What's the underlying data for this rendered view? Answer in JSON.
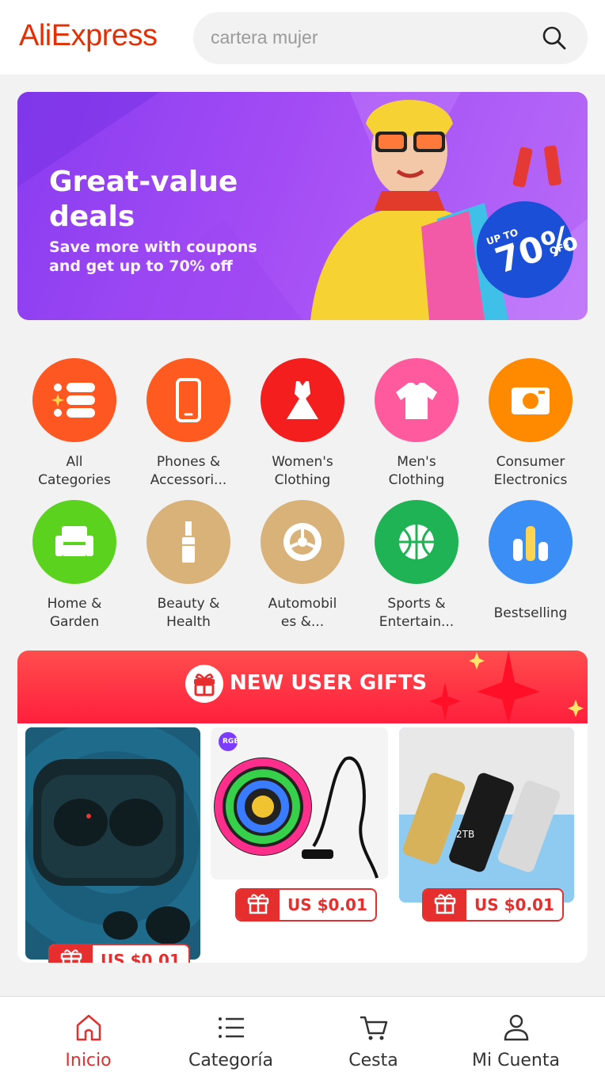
{
  "header": {
    "logo": "AliExpress",
    "search_placeholder": "cartera mujer"
  },
  "banner": {
    "title_line1": "Great-value",
    "title_line2": "deals",
    "subtitle_line1": "Save more with coupons",
    "subtitle_line2": "and get up to 70% off",
    "badge_top": "UP TO",
    "badge_value": "70%",
    "badge_bottom": "OFF"
  },
  "categories": [
    {
      "line1": "All",
      "line2": "Categories",
      "icon": "all-categories-icon",
      "color": "#ff5722"
    },
    {
      "line1": "Phones &",
      "line2": "Accessori...",
      "icon": "phone-icon",
      "color": "#ff5a1f"
    },
    {
      "line1": "Women's",
      "line2": "Clothing",
      "icon": "dress-icon",
      "color": "#f51e1e"
    },
    {
      "line1": "Men's",
      "line2": "Clothing",
      "icon": "tshirt-icon",
      "color": "#ff5a9e"
    },
    {
      "line1": "Consumer",
      "line2": "Electronics",
      "icon": "camera-icon",
      "color": "#ff8a00"
    },
    {
      "line1": "Home &",
      "line2": "Garden",
      "icon": "armchair-icon",
      "color": "#5ad21e"
    },
    {
      "line1": "Beauty &",
      "line2": "Health",
      "icon": "lipstick-icon",
      "color": "#d9b27a"
    },
    {
      "line1": "Automobil",
      "line2": "es &...",
      "icon": "wheel-icon",
      "color": "#d9b27a"
    },
    {
      "line1": "Sports &",
      "line2": "Entertain...",
      "icon": "basketball-icon",
      "color": "#1fb356"
    },
    {
      "line1": "Bestselling",
      "line2": "",
      "icon": "bar-chart-icon",
      "color": "#3a8ef5"
    }
  ],
  "gifts": {
    "title": "NEW USER GIFTS",
    "products": [
      {
        "name": "wireless-earbuds",
        "price": "US $0.01"
      },
      {
        "name": "rgb-led-strip",
        "price": "US $0.01",
        "badge": "RGB"
      },
      {
        "name": "usb-flash-drive",
        "price": "US $0.01",
        "drive_label": "2TB"
      }
    ]
  },
  "nav": {
    "items": [
      {
        "label": "Inicio",
        "active": true
      },
      {
        "label": "Categoría",
        "active": false
      },
      {
        "label": "Cesta",
        "active": false
      },
      {
        "label": "Mi Cuenta",
        "active": false
      }
    ]
  },
  "colors": {
    "brand": "#e62e04",
    "price_red": "#e62e2e"
  }
}
